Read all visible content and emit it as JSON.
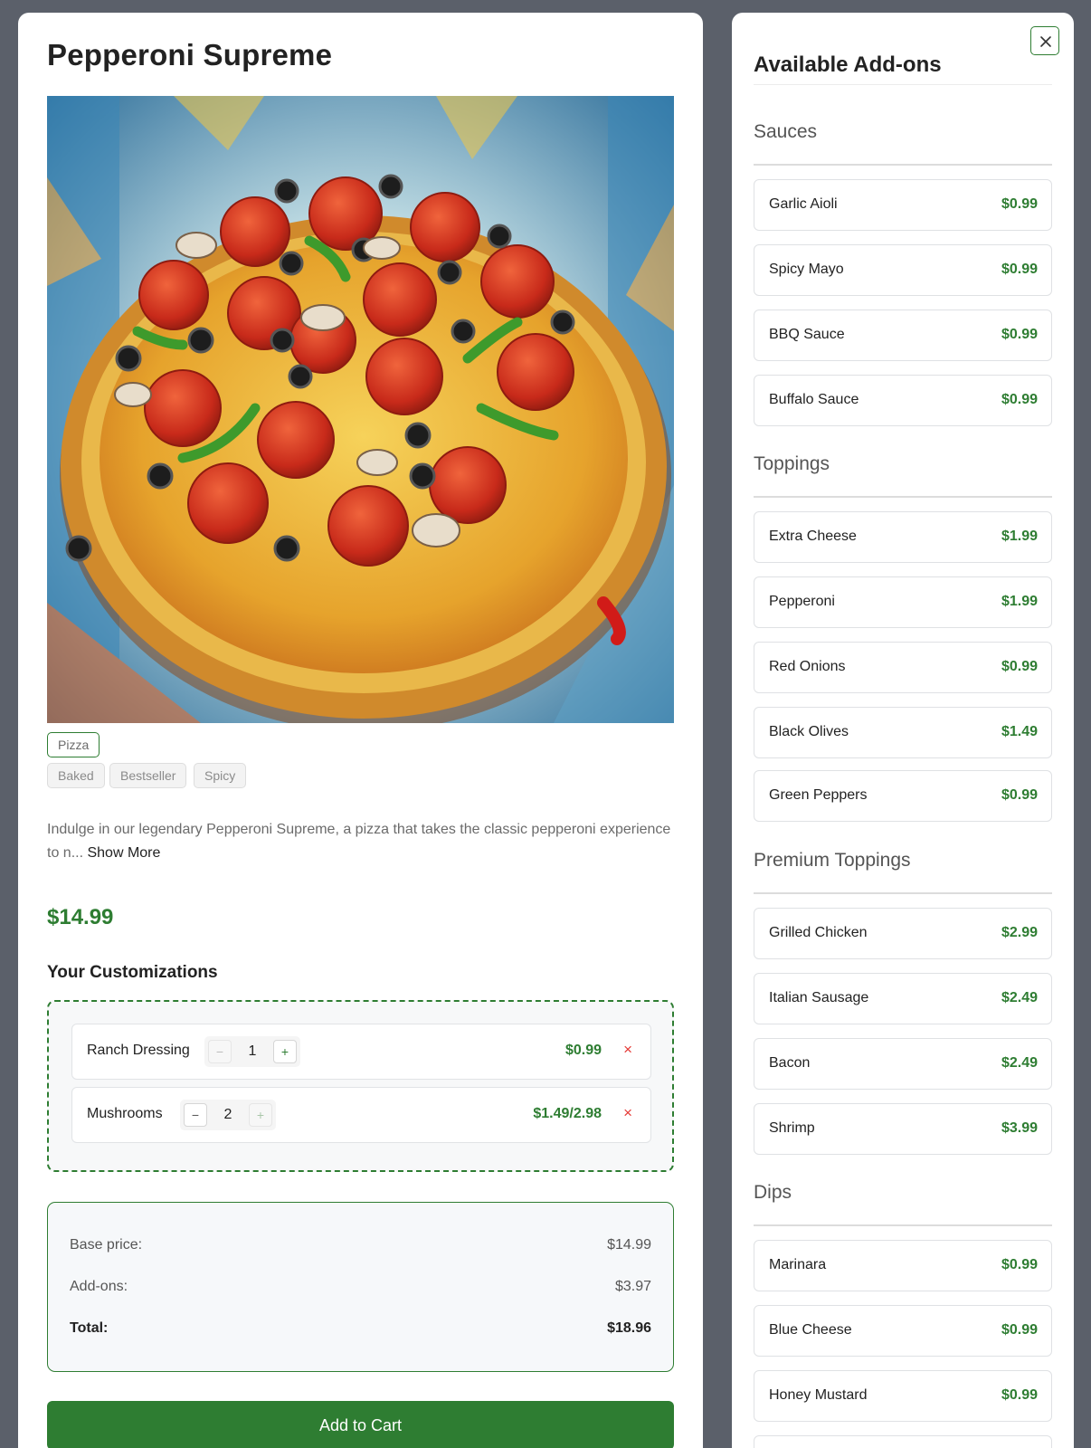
{
  "product": {
    "title": "Pepperoni Supreme",
    "category_tag": "Pizza",
    "tags": [
      "Baked",
      "Bestseller",
      "Spicy"
    ],
    "description": "Indulge in our legendary Pepperoni Supreme, a pizza that takes the classic pepperoni experience to n...",
    "show_more": "Show More",
    "price": "$14.99"
  },
  "customizations": {
    "heading": "Your Customizations",
    "items": [
      {
        "name": "Ranch Dressing",
        "qty": "1",
        "minus": "−",
        "plus": "+",
        "price": "$0.99",
        "remove": "×"
      },
      {
        "name": "Mushrooms",
        "qty": "2",
        "minus": "−",
        "plus": "+",
        "price": "$1.49/2.98",
        "remove": "×"
      }
    ]
  },
  "summary": {
    "base_label": "Base price:",
    "base_value": "$14.99",
    "addons_label": "Add-ons:",
    "addons_value": "$3.97",
    "total_label": "Total:",
    "total_value": "$18.96"
  },
  "cart_button": "Add to Cart",
  "addons": {
    "title": "Available Add-ons",
    "close_icon": "close-icon",
    "sections": [
      {
        "label": "Sauces",
        "items": [
          {
            "name": "Garlic Aioli",
            "price": "$0.99"
          },
          {
            "name": "Spicy Mayo",
            "price": "$0.99"
          },
          {
            "name": "BBQ Sauce",
            "price": "$0.99"
          },
          {
            "name": "Buffalo Sauce",
            "price": "$0.99"
          }
        ]
      },
      {
        "label": "Toppings",
        "items": [
          {
            "name": "Extra Cheese",
            "price": "$1.99"
          },
          {
            "name": "Pepperoni",
            "price": "$1.99"
          },
          {
            "name": "Red Onions",
            "price": "$0.99"
          },
          {
            "name": "Black Olives",
            "price": "$1.49"
          },
          {
            "name": "Green Peppers",
            "price": "$0.99"
          }
        ]
      },
      {
        "label": "Premium Toppings",
        "items": [
          {
            "name": "Grilled Chicken",
            "price": "$2.99"
          },
          {
            "name": "Italian Sausage",
            "price": "$2.49"
          },
          {
            "name": "Bacon",
            "price": "$2.49"
          },
          {
            "name": "Shrimp",
            "price": "$3.99"
          }
        ]
      },
      {
        "label": "Dips",
        "items": [
          {
            "name": "Marinara",
            "price": "$0.99"
          },
          {
            "name": "Blue Cheese",
            "price": "$0.99"
          },
          {
            "name": "Honey Mustard",
            "price": "$0.99"
          }
        ]
      }
    ]
  },
  "colors": {
    "accent": "#2e7d32",
    "danger": "#e53935",
    "overlay": "#5b606a"
  }
}
